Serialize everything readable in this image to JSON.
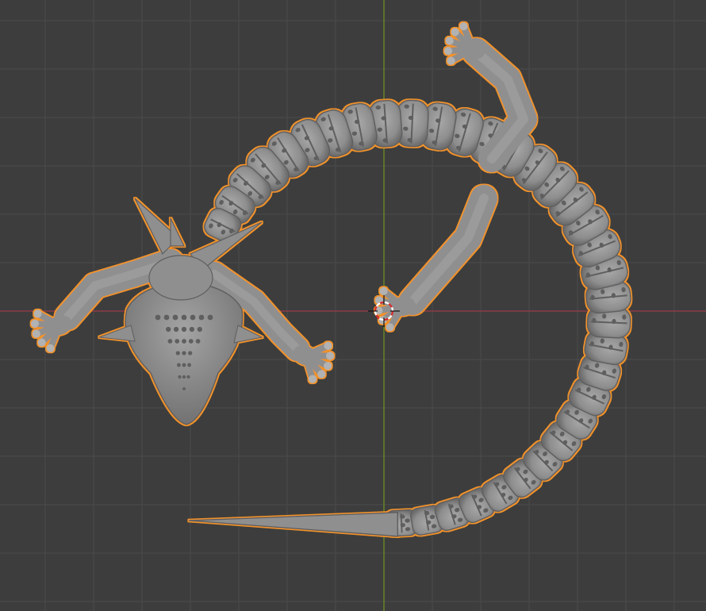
{
  "viewport": {
    "view": "top-orthographic",
    "object": "dragon-sculpt",
    "selected": true,
    "colors": {
      "background": "#3d3d3d",
      "grid_line": "#4a4a4a",
      "x_axis": "#9a3d49",
      "y_axis": "#6e8e22",
      "mesh_fill": "#8f8f8f",
      "mesh_shadow": "#5e5e5e",
      "mesh_light": "#b2b2b2",
      "selection_outline": "#f0922a",
      "cursor_red": "#d92c2c",
      "cursor_white": "#ffffff"
    }
  }
}
